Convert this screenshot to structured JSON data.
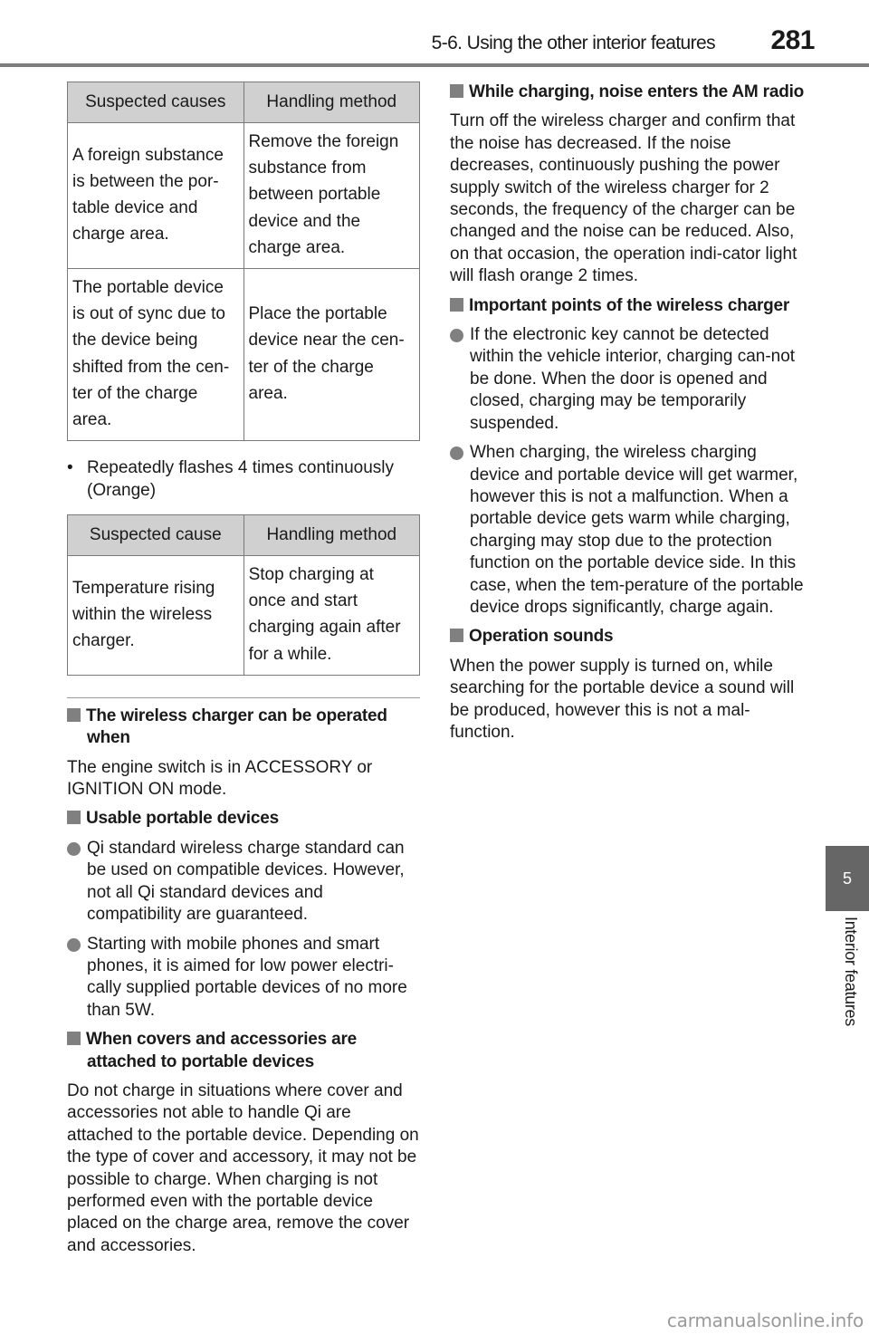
{
  "header": {
    "section_title": "5-6. Using the other interior features",
    "page_number": "281"
  },
  "side_tab": {
    "chapter_number": "5",
    "chapter_label": "Interior features"
  },
  "left_column": {
    "table1": {
      "headers": [
        "Suspected causes",
        "Handling method"
      ],
      "rows": [
        [
          "A foreign substance is between the por-table device and charge area.",
          "Remove the foreign substance from between portable device and the charge area."
        ],
        [
          "The portable device is out of sync due to the device being shifted from the cen-ter of the charge area.",
          "Place the portable device near the cen-ter of the charge area."
        ]
      ]
    },
    "bullet_flash": "Repeatedly flashes 4 times continuously (Orange)",
    "table2": {
      "headers": [
        "Suspected cause",
        "Handling method"
      ],
      "rows": [
        [
          "Temperature rising within the wireless charger.",
          "Stop charging at once and start charging again after for a while."
        ]
      ]
    },
    "sections": [
      {
        "heading": "The wireless charger can be operated when",
        "paragraph": "The engine switch is in ACCESSORY or IGNITION ON mode."
      },
      {
        "heading": "Usable portable devices",
        "items": [
          "Qi standard wireless charge standard can be used on compatible devices. However, not all Qi standard devices and compatibility are guaranteed.",
          "Starting with mobile phones and smart phones, it is aimed for low power electri-cally supplied portable devices of no more than 5W."
        ]
      },
      {
        "heading": "When covers and accessories are attached to portable devices",
        "paragraph": "Do not charge in situations where cover and accessories not able to handle Qi are attached to the portable device. Depending on the type of cover and accessory, it may not be possible to charge. When charging is not performed even with the portable device placed on the charge area, remove the cover and accessories."
      }
    ]
  },
  "right_column": {
    "sections": [
      {
        "heading": "While charging, noise enters the AM radio",
        "paragraph": "Turn off the wireless charger and confirm that the noise has decreased. If the noise decreases, continuously pushing the power supply switch of the wireless charger for 2 seconds, the frequency of the charger can be changed and the noise can be reduced. Also, on that occasion, the operation indi-cator light will flash orange 2 times."
      },
      {
        "heading": "Important points of the wireless charger",
        "items": [
          "If the electronic key cannot be detected within the vehicle interior, charging can-not be done. When the door is opened and closed, charging may be temporarily suspended.",
          "When charging, the wireless charging device and portable device will get warmer, however this is not a malfunction. When a portable device gets warm while charging, charging may stop due to the protection function on the portable device side. In this case, when the tem-perature of the portable device drops significantly, charge again."
        ]
      },
      {
        "heading": "Operation sounds",
        "paragraph": "When the power supply is turned on, while searching for the portable device a sound will be produced, however this is not a mal-function."
      }
    ]
  },
  "watermark": "carmanualsonline.info"
}
